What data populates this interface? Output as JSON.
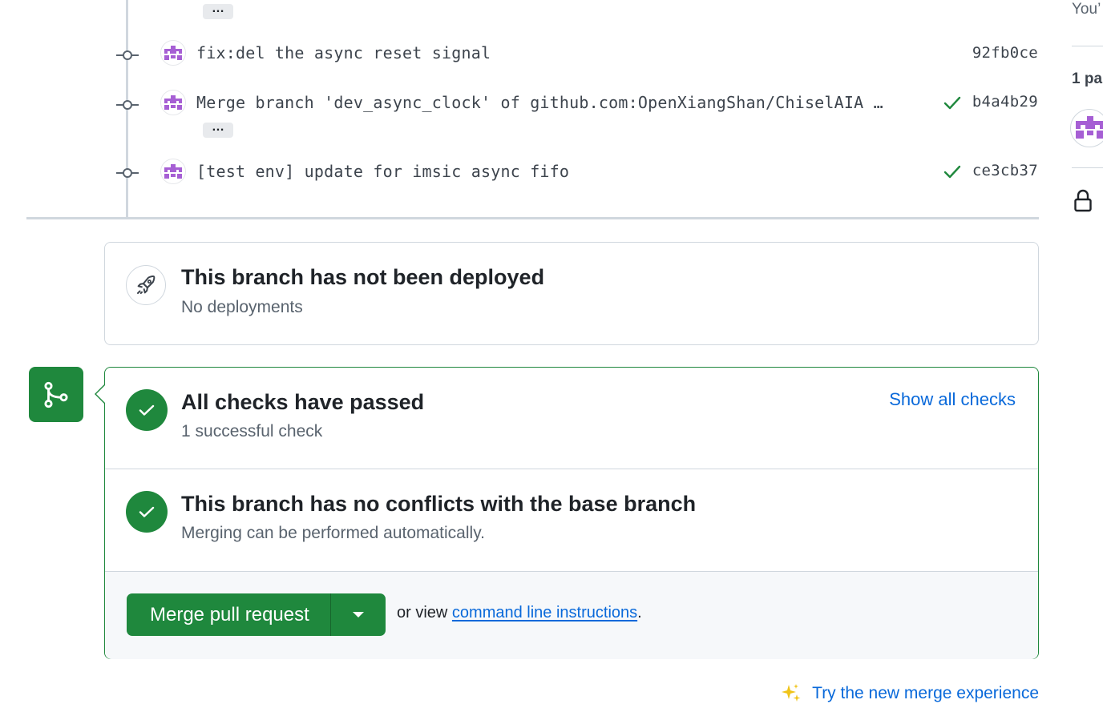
{
  "timeline": {
    "ellipsis_label": "…",
    "commits": [
      {
        "message": "fix:del the async reset signal",
        "sha": "92fb0ce",
        "status": "none"
      },
      {
        "message": "Merge branch 'dev_async_clock' of github.com:OpenXiangShan/ChiselAIA …",
        "sha": "b4a4b29",
        "status": "success",
        "has_ellipsis": true
      },
      {
        "message": "[test env] update for imsic async fifo",
        "sha": "ce3cb37",
        "status": "success"
      }
    ]
  },
  "sidebar": {
    "top_text": "You’",
    "participants_text": "1 pa",
    "lock_icon": "lock-icon"
  },
  "deployment": {
    "title": "This branch has not been deployed",
    "subtitle": "No deployments",
    "icon": "rocket-icon"
  },
  "merge_box": {
    "checks": {
      "title": "All checks have passed",
      "subtitle": "1 successful check",
      "show_all_label": "Show all checks"
    },
    "conflicts": {
      "title": "This branch has no conflicts with the base branch",
      "subtitle": "Merging can be performed automatically."
    },
    "merge_button_label": "Merge pull request",
    "or_view_text": "or view",
    "cli_link_label": "command line instructions",
    "period": "."
  },
  "try_new_label": "Try the new merge experience",
  "colors": {
    "success_green": "#1f883d",
    "link_blue": "#0969da",
    "avatar_purple": "#a65fd4"
  }
}
